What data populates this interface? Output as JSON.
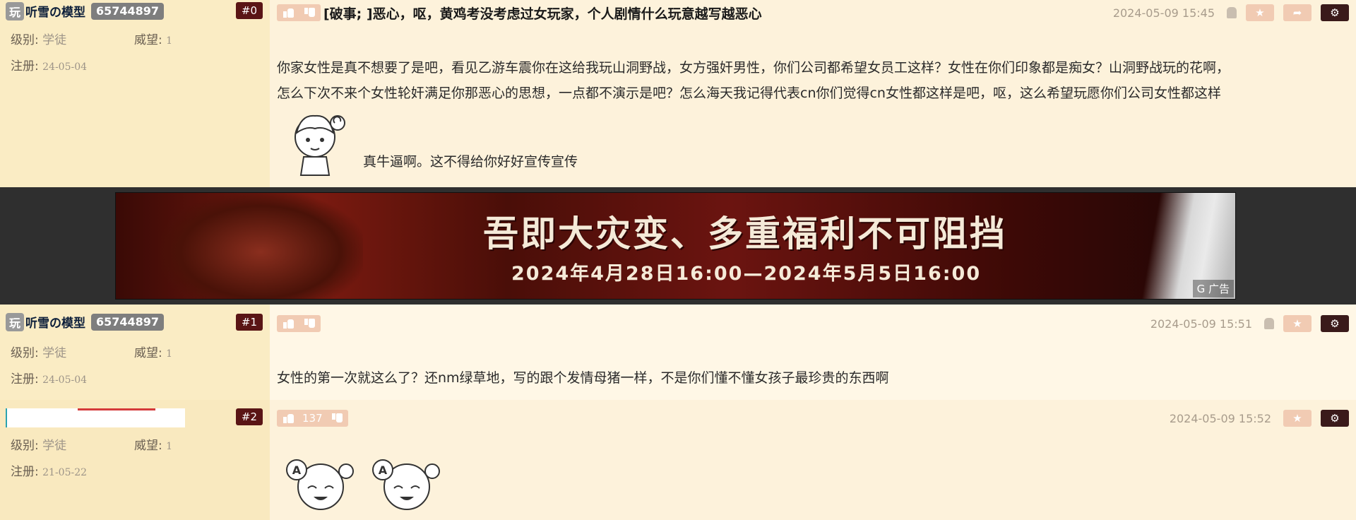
{
  "posts": [
    {
      "user": {
        "tag": "玩",
        "name": "听雪の模型",
        "uid": "65744897"
      },
      "floor": "#0",
      "level_label": "级别:",
      "level": "学徒",
      "prestige_label": "威望:",
      "prestige": "1",
      "reg_label": "注册:",
      "reg": "24-05-04",
      "title": "[破事;  ]恶心，呕，黄鸡考没考虑过女玩家，个人剧情什么玩意越写越恶心",
      "time": "2024-05-09 15:45",
      "body_lines": [
        "你家女性是真不想要了是吧，看见乙游车震你在这给我玩山洞野战，女方强奸男性，你们公司都希望女员工这样？女性在你们印象都是痴女？山洞野战玩的花啊，",
        "怎么下次不来个女性轮奸满足你那恶心的思想，一点都不演示是吧？怎么海天我记得代表cn你们觉得cn女性都这样是吧，呕，这么希望玩愿你们公司女性都这样"
      ],
      "caption": "真牛逼啊。这不得给你好好宣传宣传",
      "buttons": {
        "star": "★",
        "share": "➦",
        "gear": "⚙"
      }
    },
    {
      "user": {
        "tag": "玩",
        "name": "听雪の模型",
        "uid": "65744897"
      },
      "floor": "#1",
      "level_label": "级别:",
      "level": "学徒",
      "prestige_label": "威望:",
      "prestige": "1",
      "reg_label": "注册:",
      "reg": "24-05-04",
      "time": "2024-05-09 15:51",
      "body": "女性的第一次就这么了？还nm绿草地，写的跟个发情母猪一样，不是你们懂不懂女孩子最珍贵的东西啊",
      "buttons": {
        "star": "★",
        "gear": "⚙"
      }
    },
    {
      "floor": "#2",
      "level_label": "级别:",
      "level": "学徒",
      "prestige_label": "威望:",
      "prestige": "1",
      "reg_label": "注册:",
      "reg": "21-05-22",
      "votes": "137",
      "time": "2024-05-09 15:52",
      "buttons": {
        "star": "★",
        "gear": "⚙"
      }
    }
  ],
  "ad": {
    "headline": "吾即大灾变、多重福利不可阻挡",
    "dates": "2024年4月28日16:00—2024年5月5日16:00",
    "tag": "G 广告"
  },
  "colors": {
    "floor_badge": "#5a1515",
    "vote_bg": "#f1cbb3",
    "side_bg": "#faecc4"
  },
  "icons": {
    "android": "android-icon",
    "thumb_up": "thumb-up-icon",
    "thumb_down": "thumb-down-icon"
  }
}
